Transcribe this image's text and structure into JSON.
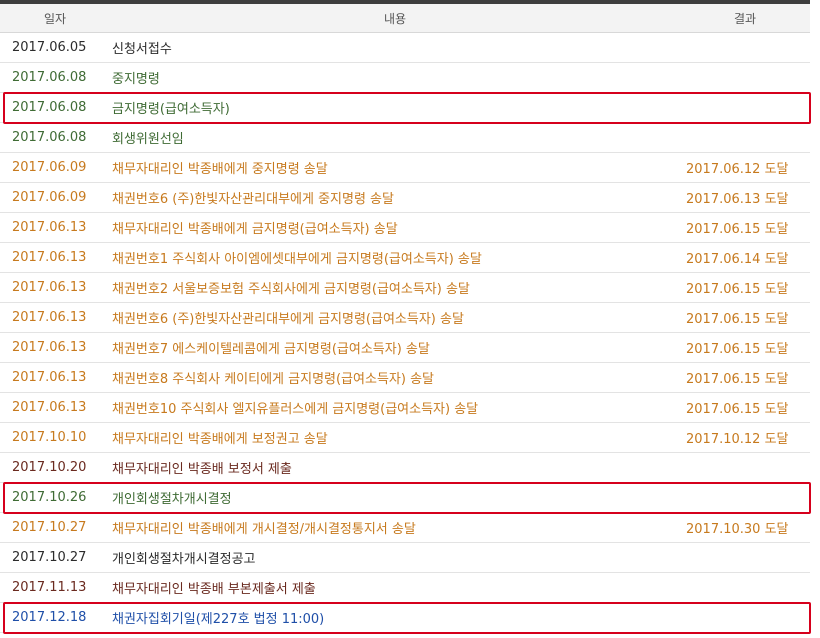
{
  "headers": {
    "date": "일자",
    "content": "내용",
    "result": "결과"
  },
  "colors": {
    "black": "#2b2b2b",
    "green": "#3f6b34",
    "orange": "#c77a1e",
    "maroon": "#6a2a1f",
    "blue": "#1f4fa8",
    "highlight": "#d6001c"
  },
  "rows": [
    {
      "date": "2017.06.05",
      "content": "신청서접수",
      "result": "",
      "tone": "black"
    },
    {
      "date": "2017.06.08",
      "content": "중지명령",
      "result": "",
      "tone": "green"
    },
    {
      "date": "2017.06.08",
      "content": "금지명령(급여소득자)",
      "result": "",
      "tone": "green",
      "highlighted": true
    },
    {
      "date": "2017.06.08",
      "content": "회생위원선임",
      "result": "",
      "tone": "green"
    },
    {
      "date": "2017.06.09",
      "content": "채무자대리인 박종배에게 중지명령 송달",
      "result": "2017.06.12 도달",
      "tone": "orange"
    },
    {
      "date": "2017.06.09",
      "content": "채권번호6 (주)한빛자산관리대부에게 중지명령 송달",
      "result": "2017.06.13 도달",
      "tone": "orange"
    },
    {
      "date": "2017.06.13",
      "content": "채무자대리인 박종배에게 금지명령(급여소득자) 송달",
      "result": "2017.06.15 도달",
      "tone": "orange"
    },
    {
      "date": "2017.06.13",
      "content": "채권번호1 주식회사 아이엠에셋대부에게 금지명령(급여소득자) 송달",
      "result": "2017.06.14 도달",
      "tone": "orange"
    },
    {
      "date": "2017.06.13",
      "content": "채권번호2 서울보증보험 주식회사에게 금지명령(급여소득자) 송달",
      "result": "2017.06.15 도달",
      "tone": "orange"
    },
    {
      "date": "2017.06.13",
      "content": "채권번호6 (주)한빛자산관리대부에게 금지명령(급여소득자) 송달",
      "result": "2017.06.15 도달",
      "tone": "orange"
    },
    {
      "date": "2017.06.13",
      "content": "채권번호7 에스케이텔레콤에게 금지명령(급여소득자) 송달",
      "result": "2017.06.15 도달",
      "tone": "orange"
    },
    {
      "date": "2017.06.13",
      "content": "채권번호8 주식회사 케이티에게 금지명령(급여소득자) 송달",
      "result": "2017.06.15 도달",
      "tone": "orange"
    },
    {
      "date": "2017.06.13",
      "content": "채권번호10 주식회사 엘지유플러스에게 금지명령(급여소득자) 송달",
      "result": "2017.06.15 도달",
      "tone": "orange"
    },
    {
      "date": "2017.10.10",
      "content": "채무자대리인 박종배에게 보정권고 송달",
      "result": "2017.10.12 도달",
      "tone": "orange"
    },
    {
      "date": "2017.10.20",
      "content": "채무자대리인 박종배 보정서 제출",
      "result": "",
      "tone": "maroon"
    },
    {
      "date": "2017.10.26",
      "content": "개인회생절차개시결정",
      "result": "",
      "tone": "green",
      "highlighted": true
    },
    {
      "date": "2017.10.27",
      "content": "채무자대리인 박종배에게 개시결정/개시결정통지서 송달",
      "result": "2017.10.30 도달",
      "tone": "orange"
    },
    {
      "date": "2017.10.27",
      "content": "개인회생절차개시결정공고",
      "result": "",
      "tone": "black"
    },
    {
      "date": "2017.11.13",
      "content": "채무자대리인 박종배 부본제출서 제출",
      "result": "",
      "tone": "maroon"
    },
    {
      "date": "2017.12.18",
      "content": "채권자집회기일(제227호 법정 11:00)",
      "result": "",
      "tone": "blue",
      "highlighted": true
    }
  ]
}
